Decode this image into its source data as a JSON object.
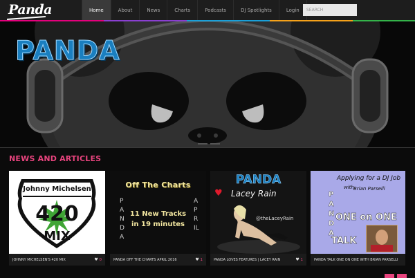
{
  "brand": {
    "logo": "Panda",
    "hero_text": "PANDA"
  },
  "nav": {
    "items": [
      "Home",
      "About",
      "News",
      "Charts",
      "Podcasts",
      "DJ Spotlights",
      "Login"
    ],
    "active": "Home"
  },
  "search": {
    "placeholder": "SEARCH"
  },
  "news": {
    "heading": "NEWS AND ARTICLES",
    "cards": [
      {
        "title": "JOHNNY MICHELSEN'S 420 MIX",
        "likes": "0",
        "image_text": {
          "line1": "Johnny Michelsen",
          "line2": "420",
          "line3": "MIX"
        }
      },
      {
        "title": "PANDA OFF THE CHARTS APRIL 2016",
        "likes": "1",
        "image_text": {
          "line1": "Off The Charts",
          "left": "PANDA",
          "right": "APRIL",
          "line2": "11 New Tracks",
          "line3": "in 19 minutes"
        }
      },
      {
        "title": "PANDA LOVES FEATURES | LACEY RAIN",
        "likes": "1",
        "image_text": {
          "line1": "PANDA",
          "line2": "Lacey Rain",
          "handle": "@theLaceyRain"
        }
      },
      {
        "title": "PANDA TALK ONE ON ONE WITH BRIAN PARSELLI",
        "likes": "1",
        "image_text": {
          "line1": "Applying for a DJ Job",
          "line2": "with",
          "line3": "Brian Parselli",
          "vertical": "PANDA",
          "one": "ONE on ONE",
          "talk": "TALK"
        }
      }
    ]
  },
  "colors": {
    "accent": "#e8447e",
    "nav_bg": "#1d1d1d",
    "hero_blue": "#1a7fc0"
  }
}
